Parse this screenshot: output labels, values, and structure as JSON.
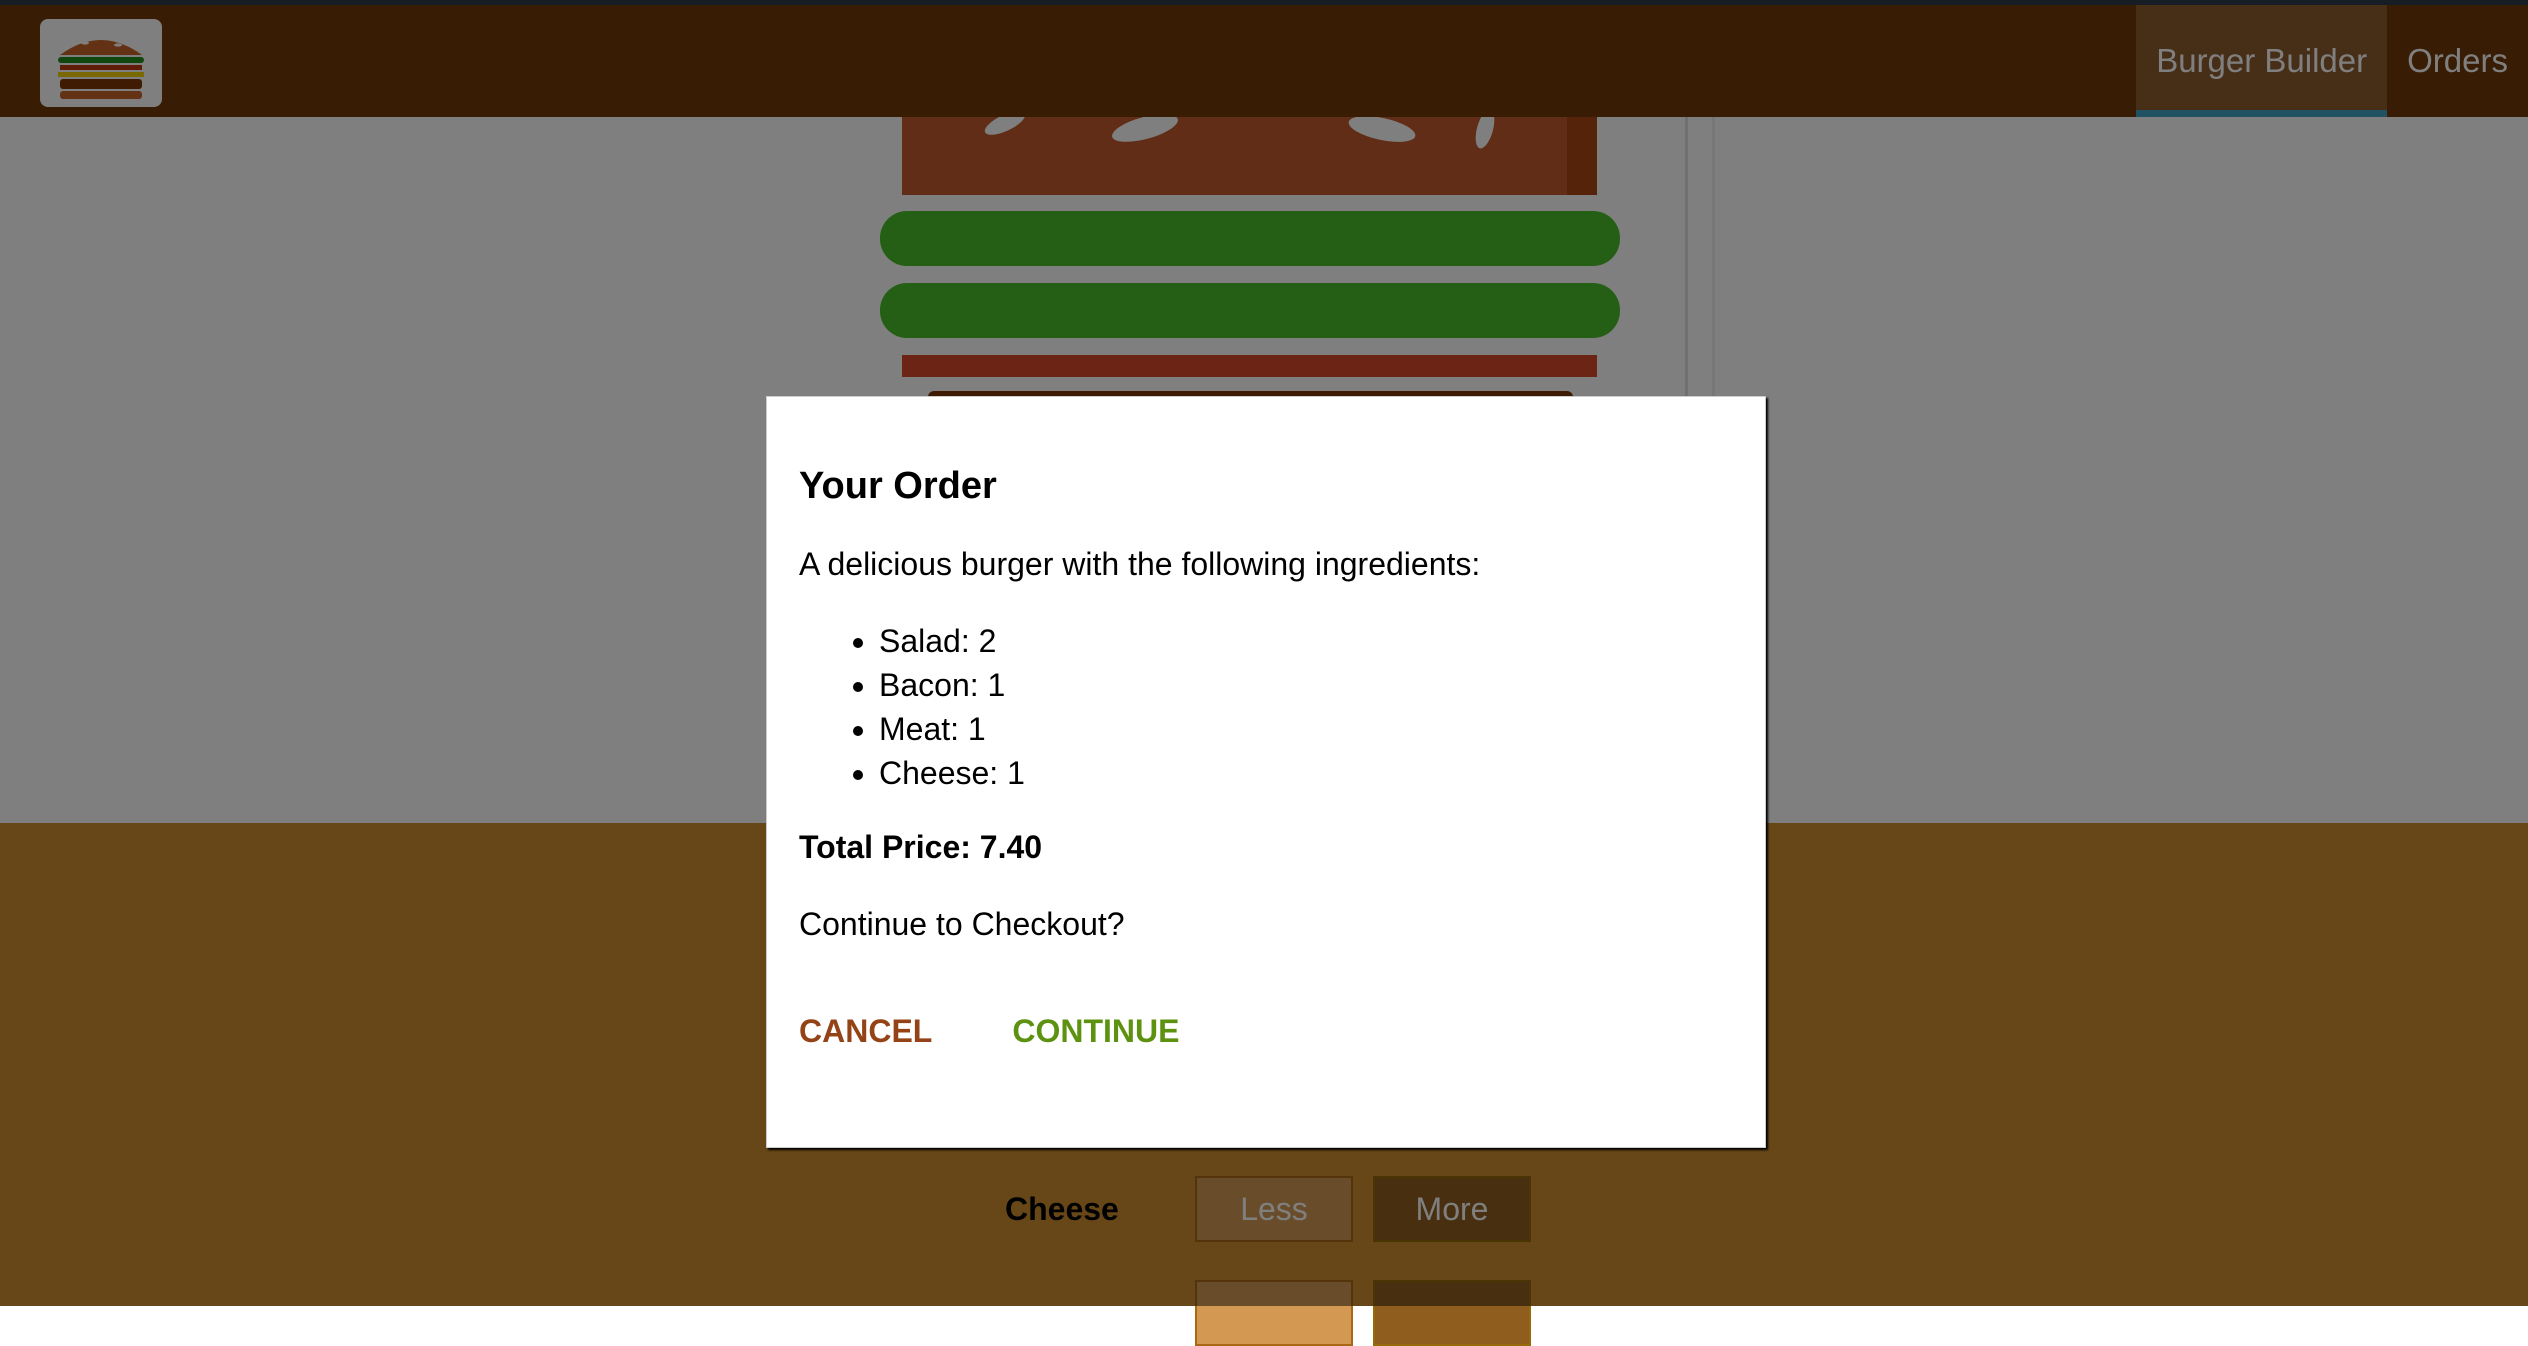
{
  "toolbar": {
    "logo_icon": "burger-logo",
    "nav": [
      {
        "label": "Burger Builder",
        "active": true
      },
      {
        "label": "Orders",
        "active": false
      }
    ]
  },
  "controls": [
    {
      "label": "Cheese",
      "less": "Less",
      "more": "More"
    }
  ],
  "modal": {
    "title": "Your Order",
    "intro": "A delicious burger with the following ingredients:",
    "ingredients": [
      {
        "label": "Salad: 2"
      },
      {
        "label": "Bacon: 1"
      },
      {
        "label": "Meat: 1"
      },
      {
        "label": "Cheese: 1"
      }
    ],
    "total": "Total Price: 7.40",
    "question": "Continue to Checkout?",
    "cancel": "CANCEL",
    "continue": "CONTINUE"
  },
  "colors": {
    "toolbar": "#703b09",
    "cancel": "#944317",
    "continue": "#5c9210",
    "nav_active_border": "#40a4c8"
  }
}
